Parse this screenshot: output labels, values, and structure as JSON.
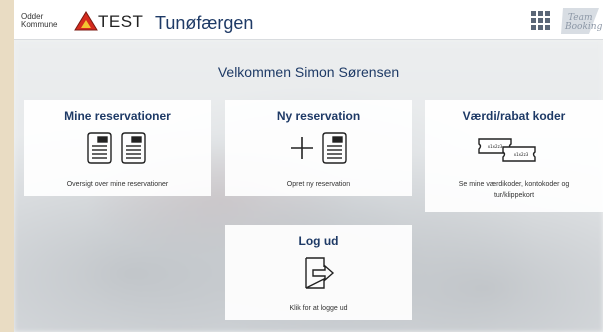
{
  "header": {
    "kommune_line1": "Odder",
    "kommune_line2": "Kommune",
    "env_label": "TEST",
    "app_title": "Tunøfærgen",
    "menu_icon": "grid-icon",
    "brand_line1": "Team",
    "brand_line2": "Booking"
  },
  "welcome": "Velkommen Simon Sørensen",
  "cards": [
    {
      "title": "Mine reservationer",
      "desc": "Oversigt over mine reservationer",
      "icon": "tickets-icon"
    },
    {
      "title": "Ny reservation",
      "desc": "Opret ny reservation",
      "icon": "plus-ticket-icon"
    },
    {
      "title": "Værdi/rabat koder",
      "desc": "Se mine værdikoder, kontokoder og tur/klippekort",
      "icon": "coupons-icon"
    },
    {
      "title": "Log ud",
      "desc": "Klik for at logge ud",
      "icon": "logout-icon"
    }
  ],
  "coupon_code_text": "x1x2z3",
  "colors": {
    "title_blue": "#1e3a66",
    "shield_red": "#d52b1e",
    "grid_gray": "#5a6677"
  }
}
